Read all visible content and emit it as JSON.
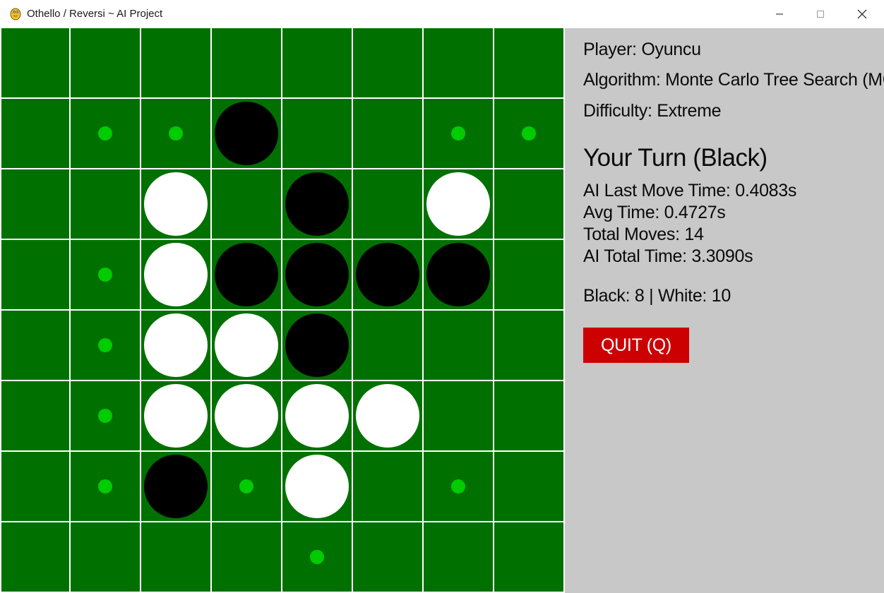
{
  "window": {
    "title": "Othello / Reversi ~ AI Project",
    "icon": "pygame-snake-icon"
  },
  "colors": {
    "board_green": "#007100",
    "grid_line": "#ffffff",
    "hint_dot": "#00cc00",
    "panel_bg": "#c8c8c8",
    "quit_bg": "#cc0000"
  },
  "board": {
    "size": 8,
    "rows": [
      "........",
      ".**B..**",
      "..W.B.W.",
      ".*WBBBB.",
      ".*WWB...",
      ".*WWWW..",
      ".*B*W.*.",
      "....*..."
    ],
    "legend": {
      "B": "black disc",
      "W": "white disc",
      "*": "valid move hint",
      ".": "empty"
    }
  },
  "panel": {
    "player": "Player: Oyuncu",
    "algorithm": "Algorithm: Monte Carlo Tree Search (MCTS)",
    "difficulty": "Difficulty: Extreme",
    "turn": "Your Turn (Black)",
    "ai_last_move_time": "AI Last Move Time: 0.4083s",
    "avg_time": "Avg Time: 0.4727s",
    "total_moves": "Total Moves: 14",
    "ai_total_time": "AI Total Time: 3.3090s",
    "score": "Black: 8 | White: 10",
    "quit_label": "QUIT (Q)"
  }
}
